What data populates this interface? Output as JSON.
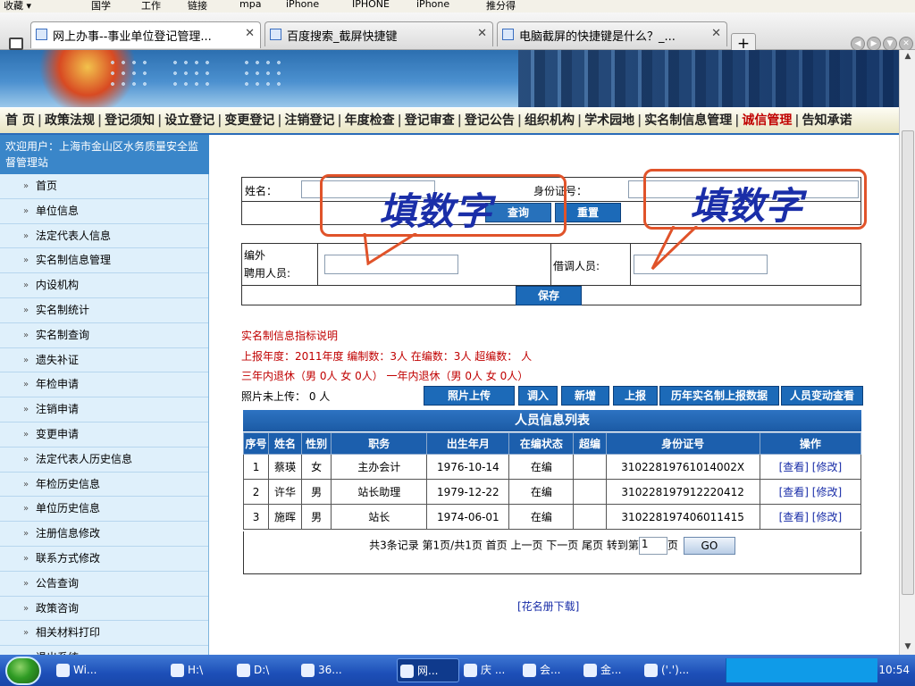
{
  "favorites_bar": [
    {
      "label": "收藏 ▾",
      "icon": "star-icon"
    },
    {
      "label": "国学",
      "icon": "folder-icon"
    },
    {
      "label": "工作",
      "icon": "folder-icon"
    },
    {
      "label": "链接",
      "icon": "folder-icon"
    },
    {
      "label": "mpa",
      "icon": "folder-icon"
    },
    {
      "label": "iPhone",
      "icon": "page-icon"
    },
    {
      "label": "IPHONE",
      "icon": "page-icon"
    },
    {
      "label": "iPhone",
      "icon": "page-icon"
    },
    {
      "label": "推分得",
      "icon": "page-icon"
    }
  ],
  "tabs": [
    {
      "title": "网上办事--事业单位登记管理...",
      "active": true
    },
    {
      "title": "百度搜索_截屏快捷键",
      "active": false
    },
    {
      "title": "电脑截屏的快捷键是什么？_...",
      "active": false
    }
  ],
  "new_tab_label": "+",
  "menu": [
    {
      "label": "首 页",
      "highlight": false
    },
    {
      "label": "政策法规",
      "highlight": false
    },
    {
      "label": "登记须知",
      "highlight": false
    },
    {
      "label": "设立登记",
      "highlight": false
    },
    {
      "label": "变更登记",
      "highlight": false
    },
    {
      "label": "注销登记",
      "highlight": false
    },
    {
      "label": "年度检查",
      "highlight": false
    },
    {
      "label": "登记审查",
      "highlight": false
    },
    {
      "label": "登记公告",
      "highlight": false
    },
    {
      "label": "组织机构",
      "highlight": false
    },
    {
      "label": "学术园地",
      "highlight": false
    },
    {
      "label": "实名制信息管理",
      "highlight": false
    },
    {
      "label": "诚信管理",
      "highlight": true
    },
    {
      "label": "告知承诺",
      "highlight": false
    }
  ],
  "welcome": "欢迎用户：上海市金山区水务质量安全监督管理站",
  "sidebar": [
    "首页",
    "单位信息",
    "法定代表人信息",
    "实名制信息管理",
    "内设机构",
    "实名制统计",
    "实名制查询",
    "遗失补证",
    "年检申请",
    "注销申请",
    "变更申请",
    "法定代表人历史信息",
    "年检历史信息",
    "单位历史信息",
    "注册信息修改",
    "联系方式修改",
    "公告查询",
    "政策咨询",
    "相关材料打印",
    "退出系统"
  ],
  "search": {
    "name_label": "姓名：",
    "id_label": "身份证号：",
    "query_button": "查询",
    "reset_button": "重置",
    "name_value": "",
    "id_value": ""
  },
  "staff": {
    "extra_label_line1": "编外",
    "extra_label_line2": "聘用人员:",
    "borrowed_label": "借调人员:",
    "save_button": "保存",
    "extra_value": "",
    "borrowed_value": ""
  },
  "callouts": [
    "填数字",
    "填数字"
  ],
  "notes": {
    "title": "实名制信息指标说明",
    "line1": "上报年度：2011年度   编制数：3人   在编数：3人   超编数：  人",
    "line2": "三年内退休（男 0人 女 0人）  一年内退休（男 0人 女 0人）",
    "photo": "照片未上传： 0 人"
  },
  "action_buttons": [
    "照片上传",
    "调入",
    "新增",
    "上报",
    "历年实名制上报数据",
    "人员变动查看"
  ],
  "table": {
    "title": "人员信息列表",
    "headers": [
      "序号",
      "姓名",
      "性别",
      "职务",
      "出生年月",
      "在编状态",
      "超编",
      "身份证号",
      "操作"
    ],
    "rows": [
      {
        "no": "1",
        "name": "蔡瑛",
        "sex": "女",
        "post": "主办会计",
        "birth": "1976-10-14",
        "status": "在编",
        "over": "",
        "id": "31022819761014002X",
        "view": "[查看]",
        "edit": "[修改]"
      },
      {
        "no": "2",
        "name": "许华",
        "sex": "男",
        "post": "站长助理",
        "birth": "1979-12-22",
        "status": "在编",
        "over": "",
        "id": "310228197912220412",
        "view": "[查看]",
        "edit": "[修改]"
      },
      {
        "no": "3",
        "name": "施晖",
        "sex": "男",
        "post": "站长",
        "birth": "1974-06-01",
        "status": "在编",
        "over": "",
        "id": "310228197406011415",
        "view": "[查看]",
        "edit": "[修改]"
      }
    ]
  },
  "pager": {
    "text": "共3条记录 第1页/共1页 首页 上一页 下一页 尾页 转到第",
    "page_value": "1",
    "page_suffix": "页",
    "go_button": "GO"
  },
  "download_link": "[花名册下载]",
  "taskbar": {
    "items": [
      {
        "label": "Wi...",
        "active": false
      },
      {
        "label": "H:\\",
        "active": false
      },
      {
        "label": "D:\\",
        "active": false
      },
      {
        "label": "36...",
        "active": false
      },
      {
        "label": "网...",
        "active": true
      },
      {
        "label": "庆 ...",
        "active": false
      },
      {
        "label": "会...",
        "active": false
      },
      {
        "label": "金...",
        "active": false
      },
      {
        "label": "('.')...",
        "active": false
      }
    ],
    "clock": "10:54"
  },
  "colors": {
    "accent": "#1c6ab8",
    "callout_border": "#e0532a",
    "callout_text": "#1a2ea8",
    "note_red": "#c00000"
  }
}
